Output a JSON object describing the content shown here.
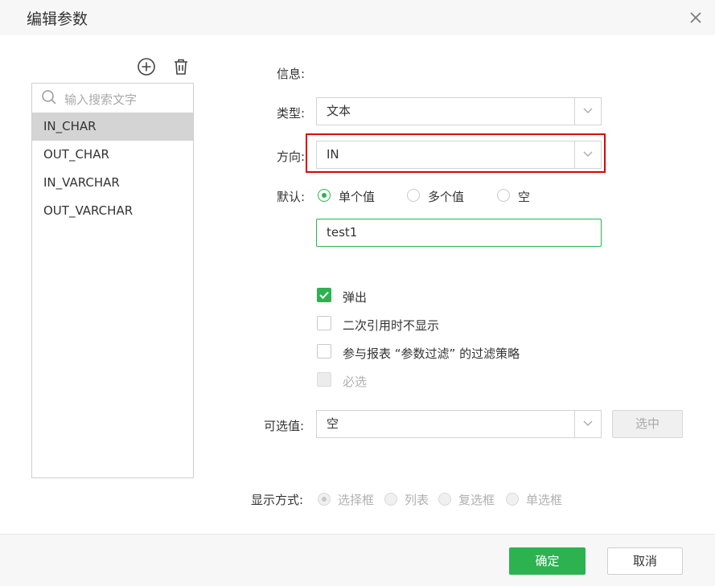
{
  "dialog": {
    "title": "编辑参数"
  },
  "param_list": {
    "search_placeholder": "输入搜索文字",
    "items": [
      {
        "label": "IN_CHAR",
        "selected": true
      },
      {
        "label": "OUT_CHAR"
      },
      {
        "label": "IN_VARCHAR"
      },
      {
        "label": "OUT_VARCHAR"
      }
    ]
  },
  "form": {
    "info_label": "信息:",
    "type_label": "类型:",
    "type_value": "文本",
    "direction_label": "方向:",
    "direction_value": "IN",
    "default_label": "默认:",
    "default_options": [
      "单个值",
      "多个值",
      "空"
    ],
    "default_selected": "单个值",
    "default_value": "test1",
    "checkboxes": [
      {
        "label": "弹出",
        "checked": true,
        "disabled": false
      },
      {
        "label": "二次引用时不显示",
        "checked": false,
        "disabled": false
      },
      {
        "label": "参与报表 “参数过滤” 的过滤策略",
        "checked": false,
        "disabled": false
      },
      {
        "label": "必选",
        "checked": false,
        "disabled": true
      }
    ],
    "optional_label": "可选值:",
    "optional_value": "空",
    "select_button": "选中",
    "display_label": "显示方式:",
    "display_options": [
      "选择框",
      "列表",
      "复选框",
      "单选框"
    ],
    "display_selected": "选择框"
  },
  "footer": {
    "ok": "确定",
    "cancel": "取消"
  },
  "colors": {
    "accent": "#2cb350",
    "highlight": "#e00000"
  }
}
